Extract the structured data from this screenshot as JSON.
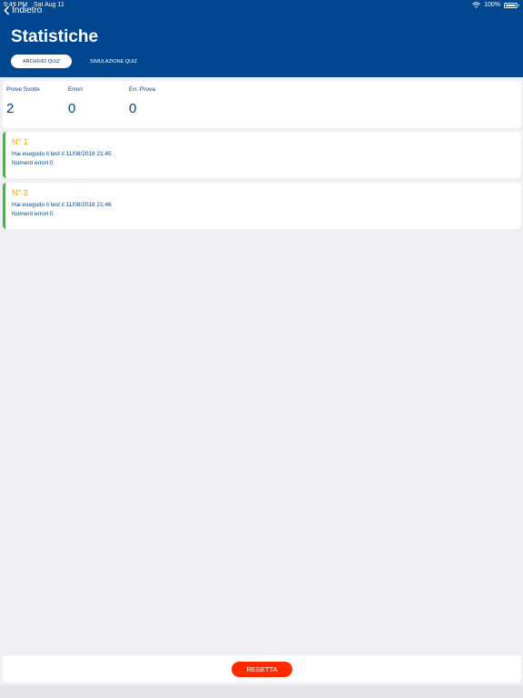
{
  "status": {
    "time": "9:49 PM",
    "date": "Sat Aug 11",
    "battery": "100%"
  },
  "header": {
    "back_label": "Indietro",
    "title": "Statistiche"
  },
  "tabs": [
    {
      "label": "ARCHIVIO QUIZ",
      "active": true
    },
    {
      "label": "SIMULAZIONE QUIZ",
      "active": false
    }
  ],
  "stats": [
    {
      "label": "Prove Svolte",
      "value": "2"
    },
    {
      "label": "Errori",
      "value": "0"
    },
    {
      "label": "Err. Prova",
      "value": "0"
    }
  ],
  "entries": [
    {
      "number": "N° 1",
      "line1": "Hai eseguito il test il 11/08/2018 21:45",
      "line2": "Numero errori 0"
    },
    {
      "number": "N° 2",
      "line1": "Hai eseguito il test il 11/08/2018 21:46",
      "line2": "Numero errori 0"
    }
  ],
  "footer": {
    "reset_label": "RESETTA"
  },
  "colors": {
    "header": "#00478f",
    "accent_orange": "#f2a11a",
    "accent_green": "#35c133",
    "reset": "#ff2b00"
  }
}
